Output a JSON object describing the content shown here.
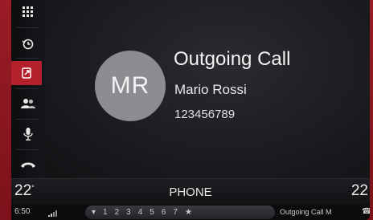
{
  "sidebar": {
    "items": [
      {
        "name": "menu-grid-icon"
      },
      {
        "name": "recent-calls-icon"
      },
      {
        "name": "outgoing-call-icon",
        "active": true
      },
      {
        "name": "contacts-icon"
      },
      {
        "name": "microphone-icon"
      },
      {
        "name": "hang-up-icon"
      }
    ]
  },
  "call": {
    "status": "Outgoing Call",
    "initials": "MR",
    "name": "Mario Rossi",
    "number": "123456789"
  },
  "climate": {
    "left_temp": "22",
    "right_temp": "22",
    "degree_mark": "°"
  },
  "header": {
    "title": "PHONE"
  },
  "status_bar": {
    "time": "6:50",
    "favorites": [
      "1",
      "2",
      "3",
      "4",
      "5",
      "6",
      "7"
    ],
    "text": "Outgoing Call M"
  },
  "colors": {
    "accent": "#b3222c",
    "frame": "#8a1a22",
    "background": "#121315"
  }
}
